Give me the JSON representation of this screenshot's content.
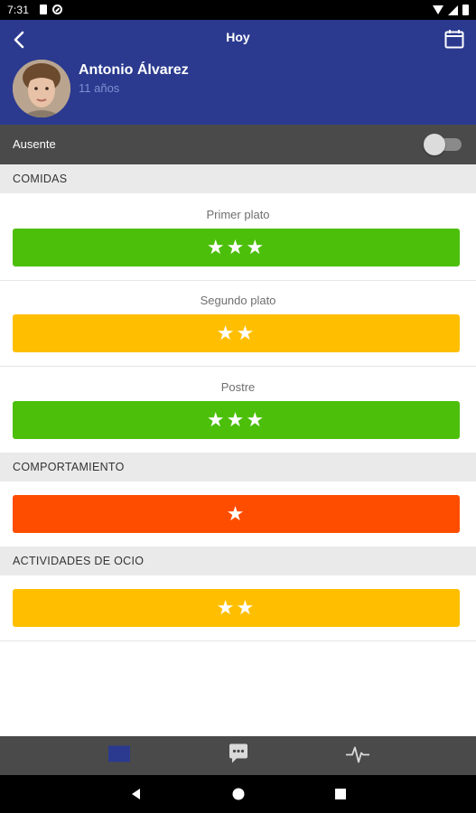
{
  "status_bar": {
    "time": "7:31",
    "left_icons": [
      "sim-card-icon",
      "do-not-disturb-icon"
    ],
    "right_icons": [
      "wifi-icon",
      "signal-icon",
      "battery-icon"
    ]
  },
  "header": {
    "title": "Hoy",
    "child_name": "Antonio Álvarez",
    "child_age": "11 años",
    "background_color": "#2b3a8f",
    "icons": {
      "back": "back-arrow-icon",
      "calendar": "calendar-icon",
      "avatar": "child-avatar"
    }
  },
  "absent": {
    "label": "Ausente",
    "toggle_on": false
  },
  "sections": {
    "meals": {
      "title": "COMIDAS",
      "items": [
        {
          "label": "Primer plato",
          "stars": "★★★",
          "rating": 3,
          "color": "#4cbf0a"
        },
        {
          "label": "Segundo plato",
          "stars": "★★",
          "rating": 2,
          "color": "#ffbf00"
        },
        {
          "label": "Postre",
          "stars": "★★★",
          "rating": 3,
          "color": "#4cbf0a"
        }
      ]
    },
    "behaviour": {
      "title": "COMPORTAMIENTO",
      "stars": "★",
      "rating": 1,
      "color": "#ff4d00"
    },
    "leisure": {
      "title": "ACTIVIDADES DE OCIO",
      "stars": "★★",
      "rating": 2,
      "color": "#ffbf00"
    }
  },
  "bottom_nav": {
    "items": [
      {
        "icon": "calendar-list-icon",
        "active": true,
        "color": "#2b3a8f"
      },
      {
        "icon": "chat-bubble-icon",
        "active": false,
        "color": "#d9d9d9"
      },
      {
        "icon": "activity-pulse-icon",
        "active": false,
        "color": "#d9d9d9"
      }
    ]
  },
  "system_nav": {
    "buttons": [
      "back-triangle-icon",
      "home-circle-icon",
      "recents-square-icon"
    ]
  }
}
